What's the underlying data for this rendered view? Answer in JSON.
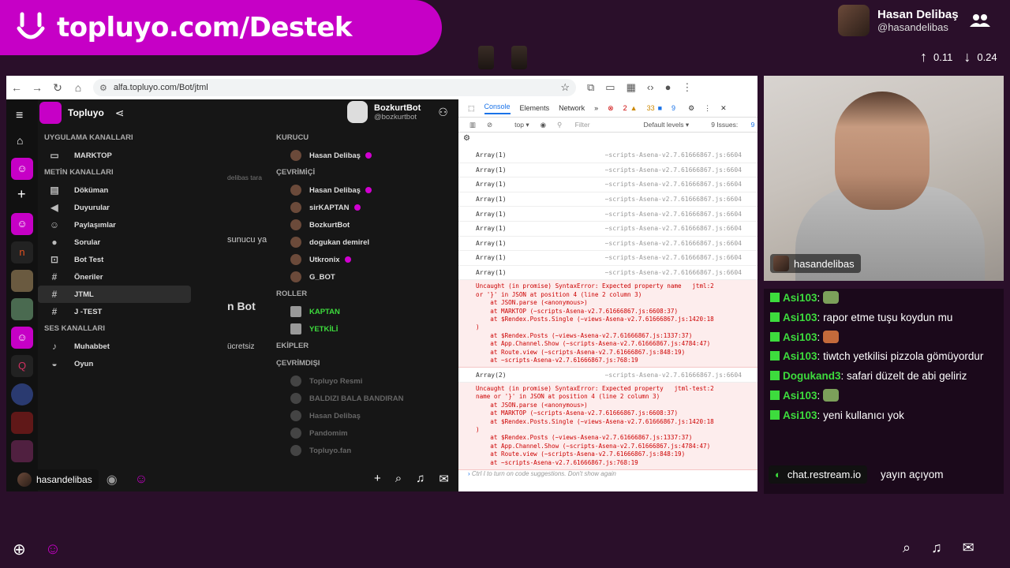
{
  "overlay": {
    "banner_text": "topluyo.com/Destek",
    "host_name": "Hasan Delibaş",
    "host_handle": "@hasandelibas",
    "rate_up": "0.11",
    "rate_down": "0.24"
  },
  "browser": {
    "url": "alfa.topluyo.com/Bot/jtml"
  },
  "app": {
    "title": "Topluyo",
    "bot_name": "BozkurtBot",
    "bot_handle": "@bozkurtbot",
    "middle_fragments": [
      "delibas tara",
      "sunucu ya",
      "n Bot",
      "ücretsiz"
    ],
    "sections": [
      {
        "title": "UYGULAMA KANALLARI",
        "channels": [
          {
            "icon": "monitor-icon",
            "label": "MARKTOP"
          }
        ]
      },
      {
        "title": "METİN KANALLARI",
        "channels": [
          {
            "icon": "doc-icon",
            "label": "Döküman"
          },
          {
            "icon": "megaphone-icon",
            "label": "Duyurular"
          },
          {
            "icon": "smile-icon",
            "label": "Paylaşımlar"
          },
          {
            "icon": "chat-bubble-icon",
            "label": "Sorular"
          },
          {
            "icon": "robot-icon",
            "label": "Bot Test"
          },
          {
            "icon": "hash-icon",
            "label": "Öneriler"
          },
          {
            "icon": "hash-icon",
            "label": "JTML"
          },
          {
            "icon": "hash-icon",
            "label": "J -TEST"
          }
        ]
      },
      {
        "title": "SES KANALLARI",
        "channels": [
          {
            "icon": "speaker-icon",
            "label": "Muhabbet"
          },
          {
            "icon": "gamepad-icon",
            "label": "Oyun"
          }
        ]
      }
    ],
    "members": [
      {
        "section": "KURUCU",
        "rows": [
          {
            "name": "Hasan Delibaş",
            "dot": true
          }
        ]
      },
      {
        "section": "ÇEVRİMİÇİ",
        "rows": [
          {
            "name": "Hasan Delibaş",
            "dot": true
          },
          {
            "name": "sirKAPTAN",
            "dot": true
          },
          {
            "name": "BozkurtBot",
            "dot": false
          },
          {
            "name": "dogukan demirel",
            "dot": false
          },
          {
            "name": "Utkronix",
            "dot": true
          },
          {
            "name": "G_BOT",
            "dot": false
          }
        ]
      },
      {
        "section": "ROLLER",
        "rows": [
          {
            "name": "KAPTAN",
            "green": true
          },
          {
            "name": "YETKİLİ",
            "green": true
          }
        ]
      },
      {
        "section": "EKİPLER",
        "rows": []
      },
      {
        "section": "ÇEVRİMDIŞI",
        "rows": [
          {
            "name": "Topluyo Resmi",
            "dim": true
          },
          {
            "name": "BALDIZI BALA BANDIRAN",
            "dim": true
          },
          {
            "name": "Hasan Delibaş",
            "dim": true
          },
          {
            "name": "Pandomim",
            "dim": true
          },
          {
            "name": "Topluyo.fan",
            "dim": true
          }
        ]
      }
    ],
    "footer_user": "hasandelibas"
  },
  "devtools": {
    "tabs": [
      "Console",
      "Elements",
      "Network"
    ],
    "error_count": "2",
    "warn_count": "33",
    "info_count": "9",
    "context": "top",
    "filter_placeholder": "Filter",
    "levels": "Default levels",
    "issues": "9 Issues:",
    "issues_count": "9",
    "log_rows": [
      {
        "text": "Array(1)",
        "src": "~scripts-Asena-v2.7.61666867.js:6604"
      },
      {
        "text": "Array(1)",
        "src": "~scripts-Asena-v2.7.61666867.js:6604"
      },
      {
        "text": "Array(1)",
        "src": "~scripts-Asena-v2.7.61666867.js:6604"
      },
      {
        "text": "Array(1)",
        "src": "~scripts-Asena-v2.7.61666867.js:6604"
      },
      {
        "text": "Array(1)",
        "src": "~scripts-Asena-v2.7.61666867.js:6604"
      },
      {
        "text": "Array(1)",
        "src": "~scripts-Asena-v2.7.61666867.js:6604"
      },
      {
        "text": "Array(1)",
        "src": "~scripts-Asena-v2.7.61666867.js:6604"
      },
      {
        "text": "Array(1)",
        "src": "~scripts-Asena-v2.7.61666867.js:6604"
      },
      {
        "text": "Array(1)",
        "src": "~scripts-Asena-v2.7.61666867.js:6604"
      }
    ],
    "error1": "Uncaught (in promise) SyntaxError: Expected property name   jtml:2\nor '}' in JSON at position 4 (line 2 column 3)\n    at JSON.parse (<anonymous>)\n    at MARKTOP (~scripts-Asena-v2.7.61666867.js:6608:37)\n    at $Rendex.Posts.Single (~views-Asena-v2.7.61666867.js:1420:18\n)\n    at $Rendex.Posts (~views-Asena-v2.7.61666867.js:1337:37)\n    at App.Channel.Show (~scripts-Asena-v2.7.61666867.js:4784:47)\n    at Route.view (~scripts-Asena-v2.7.61666867.js:848:19)\n    at ~scripts-Asena-v2.7.61666867.js:768:19",
    "mid_row": {
      "text": "Array(2)",
      "src": "~scripts-Asena-v2.7.61666867.js:6604"
    },
    "error2": "Uncaught (in promise) SyntaxError: Expected property   jtml-test:2\nname or '}' in JSON at position 4 (line 2 column 3)\n    at JSON.parse (<anonymous>)\n    at MARKTOP (~scripts-Asena-v2.7.61666867.js:6608:37)\n    at $Rendex.Posts.Single (~views-Asena-v2.7.61666867.js:1420:18\n)\n    at $Rendex.Posts (~views-Asena-v2.7.61666867.js:1337:37)\n    at App.Channel.Show (~scripts-Asena-v2.7.61666867.js:4784:47)\n    at Route.view (~scripts-Asena-v2.7.61666867.js:848:19)\n    at ~scripts-Asena-v2.7.61666867.js:768:19",
    "input_hint": "Ctrl  I  to turn on code suggestions. Don't show again"
  },
  "webcam": {
    "name": "hasandelibas"
  },
  "chat": [
    {
      "user": "Asi103",
      "text": "",
      "emote": "pepe"
    },
    {
      "user": "Asi103",
      "text": "rapor etme tuşu koydun mu"
    },
    {
      "user": "Asi103",
      "text": "",
      "emote": "orange"
    },
    {
      "user": "Asi103",
      "text": "tiwtch yetkilisi pizzola gömüyordur"
    },
    {
      "user": "Dogukand3",
      "text": "safari düzelt de abi geliriz"
    },
    {
      "user": "Asi103",
      "text": "",
      "emote": "pepe"
    },
    {
      "user": "Asi103",
      "text": "yeni kullanıcı yok"
    }
  ],
  "chat_partial": "yayın açıyom",
  "restream": "chat.restream.io"
}
